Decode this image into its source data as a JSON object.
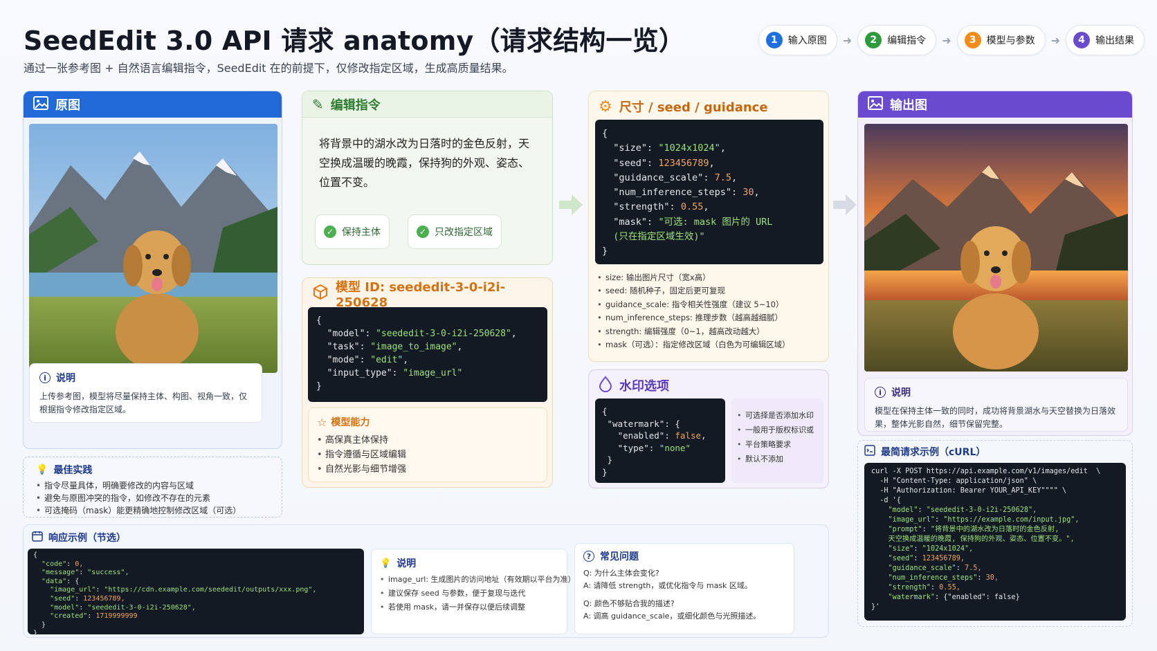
{
  "header": {
    "title": "SeedEdit 3.0 API 请求 anatomy（请求结构一览）",
    "subtitle": "通过一张参考图 + 自然语言编辑指令，SeedEdit 在的前提下，仅修改指定区域，生成高质量结果。"
  },
  "steps": [
    {
      "num": "1",
      "label": "输入原图",
      "color": "#1f6fe0"
    },
    {
      "num": "2",
      "label": "编辑指令",
      "color": "#2e9a3c"
    },
    {
      "num": "3",
      "label": "模型与参数",
      "color": "#f08c1a"
    },
    {
      "num": "4",
      "label": "输出结果",
      "color": "#6a4bd0"
    }
  ],
  "original": {
    "title": "原图",
    "note_title": "说明",
    "note_text": "上传参考图，模型将尽量保持主体、构图、视角一致，仅根据指令修改指定区域。"
  },
  "best": {
    "title": "最佳实践",
    "items": [
      "指令尽量具体，明确要修改的内容与区域",
      "避免与原图冲突的指令，如修改不存在的元素",
      "可选掩码（mask）能更精确地控制修改区域（可选）"
    ]
  },
  "instruction": {
    "title": "编辑指令",
    "text": "将背景中的湖水改为日落时的金色反射，天空换成温暖的晚霞，保持狗的外观、姿态、位置不变。",
    "chip1": "保持主体",
    "chip2": "只改指定区域"
  },
  "model": {
    "title": "模型 ID: seededit-3-0-i2i-250628",
    "code": {
      "k1": "\"model\"",
      "v1": "\"seededit-3-0-i2i-250628\"",
      "k2": "\"task\"",
      "v2": "\"image_to_image\"",
      "k3": "\"mode\"",
      "v3": "\"edit\"",
      "k4": "\"input_type\"",
      "v4": "\"image_url\""
    },
    "cap_title": "模型能力",
    "caps": [
      "高保真主体保持",
      "指令遵循与区域编辑",
      "自然光影与细节增强"
    ]
  },
  "params": {
    "title": "尺寸 / seed / guidance",
    "code": {
      "size_k": "\"size\"",
      "size_v": "\"1024x1024\"",
      "seed_k": "\"seed\"",
      "seed_v": "123456789",
      "gs_k": "\"guidance_scale\"",
      "gs_v": "7.5",
      "steps_k": "\"num_inference_steps\"",
      "steps_v": "30",
      "str_k": "\"strength\"",
      "str_v": "0.55",
      "mask_k": "\"mask\"",
      "mask_v1": "\"可选: mask 图片的 URL",
      "mask_v2": "(只在指定区域生效)\""
    },
    "items": [
      "size: 输出图片尺寸（宽x高）",
      "seed: 随机种子，固定后更可复现",
      "guidance_scale: 指令相关性强度（建议 5~10）",
      "num_inference_steps: 推理步数（越高越细腻）",
      "strength: 编辑强度（0~1，越高改动越大）",
      "mask（可选）：指定修改区域（白色为可编辑区域）"
    ]
  },
  "watermark": {
    "title": "水印选项",
    "code": {
      "wm_k": "\"watermark\"",
      "en_k": "\"enabled\"",
      "en_v": "false",
      "type_k": "\"type\"",
      "type_v": "\"none\""
    },
    "items": [
      "可选择是否添加水印",
      "一般用于版权标识或",
      "平台策略要求",
      "默认不添加"
    ]
  },
  "output": {
    "title": "输出图",
    "note_title": "说明",
    "note_text": "模型在保持主体一致的同时，成功将背景湖水与天空替换为日落效果，整体光影自然，细节保留完整。"
  },
  "curl": {
    "title": "最简请求示例（cURL）",
    "lines": {
      "l1": "curl -X POST https://api.example.com/v1/images/edit  \\",
      "l2": "  -H \"Content-Type: application/json\" \\",
      "l3": "  -H \"Authorization: Bearer YOUR_API_KEY\"\"\"\" \\",
      "l4": "  -d '{",
      "l5k": "\"model\"",
      "l5v": "\"seededit-3-0-i2i-250628\",",
      "l6k": "\"image_url\"",
      "l6v": "\"https://example.com/input.jpg\",",
      "l7k": "\"prompt\"",
      "l7v": "\"将背景中的湖水改为日落时的金色反射,",
      "l8": "天空换成温暖的晚霞, 保持狗的外观、姿态、位置不变。\",",
      "l9k": "\"size\"",
      "l9v": "\"1024x1024\",",
      "l10k": "\"seed\"",
      "l10v": "123456789,",
      "l11k": "\"guidance_scale\"",
      "l11v": "7.5,",
      "l12k": "\"num_inference_steps\"",
      "l12v": "30,",
      "l13k": "\"strength\"",
      "l13v": "0.55,",
      "l14k": "\"watermark\"",
      "l14v": "{\"enabled\": false}",
      "l15": "}'"
    }
  },
  "response": {
    "title": "响应示例（节选）",
    "lines": {
      "code_k": "\"code\"",
      "code_v": "0,",
      "msg_k": "\"message\"",
      "msg_v": "\"success\",",
      "data_k": "\"data\"",
      "url_k": "\"image_url\"",
      "url_v": "\"https://cdn.example.com/seededit/outputs/xxx.png\",",
      "seed_k": "\"seed\"",
      "seed_v": "123456789,",
      "model_k": "\"model\"",
      "model_v": "\"seededit-3-0-i2i-250628\",",
      "created_k": "\"created\"",
      "created_v": "1719999999"
    },
    "note_title": "说明",
    "note_items": [
      "image_url: 生成图片的访问地址（有效期以平台为准）",
      "建议保存 seed 与参数，便于复现与迭代",
      "若使用 mask，请一并保存以便后续调整"
    ]
  },
  "faq": {
    "title": "常见问题",
    "q1": "Q: 为什么主体会变化?",
    "a1": "A: 请降低 strength，或优化指令与 mask 区域。",
    "q2": "Q: 颜色不够贴合我的描述?",
    "a2": "A: 调高 guidance_scale，或细化颜色与光照描述。"
  }
}
